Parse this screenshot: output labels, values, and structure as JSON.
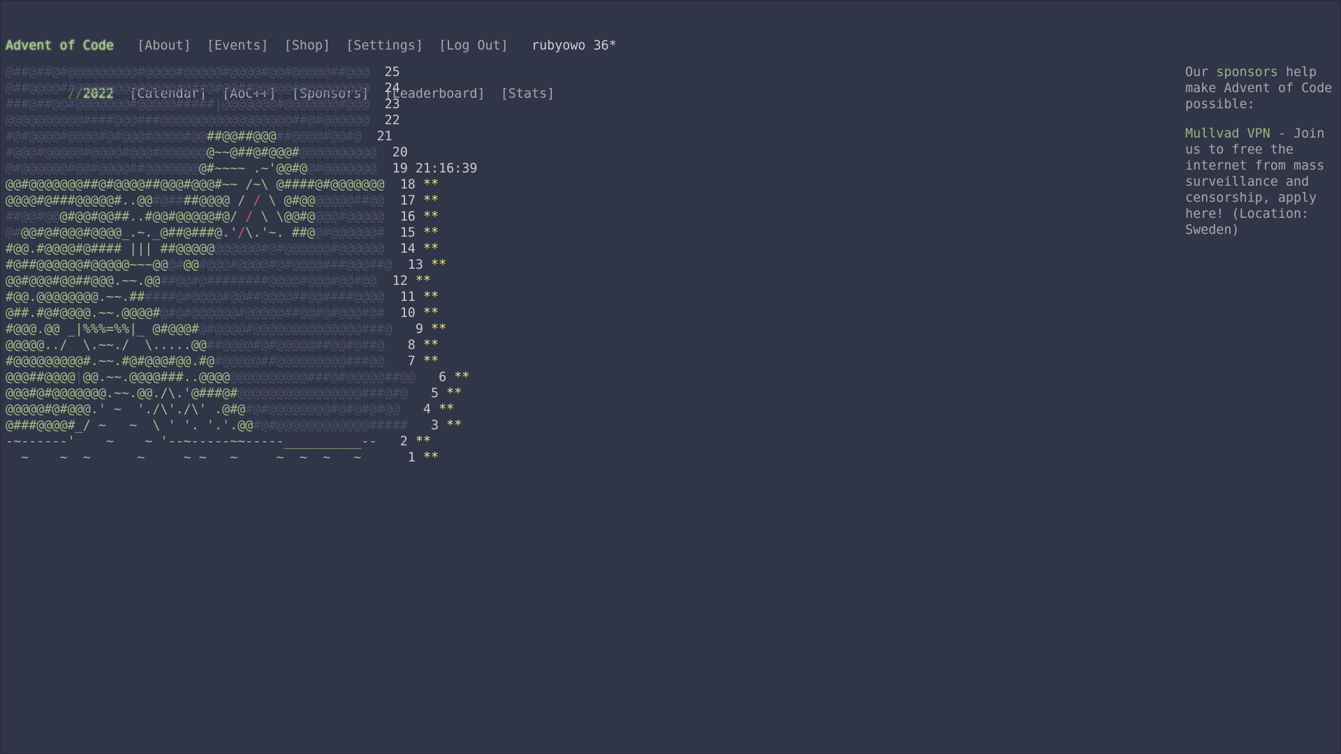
{
  "header": {
    "title": "Advent of Code",
    "nav": [
      "[About]",
      "[Events]",
      "[Shop]",
      "[Settings]",
      "[Log Out]"
    ],
    "user": "rubyowo",
    "star_count": "36*",
    "year_prefix": "//",
    "year": "2022",
    "year_nav": [
      "[Calendar]",
      "[AoC++]",
      "[Sponsors]",
      "[Leaderboard]",
      "[Stats]"
    ]
  },
  "calendar": {
    "days": [
      {
        "day": "25",
        "segments": [
          {
            "t": "@##@##@#@@@@@@@@@#@@@@#@@@@@#@@@@#@@#@@@@@##@@@",
            "c": "dim"
          }
        ],
        "timer": "",
        "stars": ""
      },
      {
        "day": "24",
        "segments": [
          {
            "t": "@##@@@@##@@@@@@@@@@@@@#@##@#@@##@@@@@#@@@@@@@@@",
            "c": "dim"
          }
        ],
        "timer": "",
        "stars": ""
      },
      {
        "day": "23",
        "segments": [
          {
            "t": "###@##@@#@@@@@@@#@@@@@#####|@@@@@@@#@@@@@@@#@@@",
            "c": "dim"
          }
        ],
        "timer": "",
        "stars": ""
      },
      {
        "day": "22",
        "segments": [
          {
            "t": "@@@@@@@@@@####@@@###@@@@@@@@@@@@@@@@@##@#@@@@@@",
            "c": "dim"
          }
        ],
        "timer": "",
        "stars": ""
      },
      {
        "day": "21",
        "segments": [
          {
            "t": "#@#@@@@#@@@@#@#@@@#@@@@#@@",
            "c": "dim"
          },
          {
            "t": "##@@##@@@",
            "c": "lit"
          },
          {
            "t": "##@@@@#@@#@",
            "c": "dim"
          }
        ],
        "timer": "",
        "stars": ""
      },
      {
        "day": "20",
        "segments": [
          {
            "t": "#@@@#@@@@@#@@@@#@@@#@@@@@@",
            "c": "dim"
          },
          {
            "t": "@~~@##@#@@@#",
            "c": "lit"
          },
          {
            "t": "@@@@@@@@@@",
            "c": "dim"
          }
        ],
        "timer": "",
        "stars": ""
      },
      {
        "day": "19",
        "segments": [
          {
            "t": "@#@@@@@@#@@#@@@@##@@@@@@@",
            "c": "dim"
          },
          {
            "t": "@#~~~~ .~'@@#@",
            "c": "lit"
          },
          {
            "t": "@#@@@@@@@",
            "c": "dim"
          }
        ],
        "timer": "21:16:39",
        "stars": ""
      },
      {
        "day": "18",
        "segments": [
          {
            "t": "@@#@@@@@@@##@#@@@@##@@@#@@@#~~ /~\\ @####",
            "c": "lit"
          },
          {
            "t": "@#@@@@@@@",
            "c": "lit"
          }
        ],
        "timer": "",
        "stars": "**"
      },
      {
        "day": "17",
        "segments": [
          {
            "t": "@@@@#@###@",
            "c": "lit"
          },
          {
            "t": "@@@@#..@@",
            "c": "lit"
          },
          {
            "t": "#@##",
            "c": "dim"
          },
          {
            "t": "##@@@@ / ",
            "c": "lit"
          },
          {
            "t": "/",
            "c": "red"
          },
          {
            "t": " \\ @#@@",
            "c": "lit"
          },
          {
            "t": "@@@@@##@@",
            "c": "dim"
          }
        ],
        "timer": "",
        "stars": "**"
      },
      {
        "day": "16",
        "segments": [
          {
            "t": "##@@#@@",
            "c": "dim"
          },
          {
            "t": "@#@@#@@##..#@@#@@@@@#@/ ",
            "c": "lit"
          },
          {
            "t": "/",
            "c": "red"
          },
          {
            "t": " \\ \\@@#@",
            "c": "lit"
          },
          {
            "t": "@@@#@@@@@",
            "c": "dim"
          }
        ],
        "timer": "",
        "stars": "**"
      },
      {
        "day": "15",
        "segments": [
          {
            "t": "@#",
            "c": "dim"
          },
          {
            "t": "@@#@#@@@#@@@@_.~._@##@###@.'",
            "c": "lit"
          },
          {
            "t": "/",
            "c": "red"
          },
          {
            "t": "\\.'~. ##@",
            "c": "lit"
          },
          {
            "t": "@#@@@@@@#",
            "c": "dim"
          }
        ],
        "timer": "",
        "stars": "**"
      },
      {
        "day": "14",
        "segments": [
          {
            "t": "#@@.#@@@@#@#### ||| ##@@@@@",
            "c": "lit"
          },
          {
            "t": "@@@@@@#@#@@@@@@#@@@@@@",
            "c": "dim"
          }
        ],
        "timer": "",
        "stars": "**"
      },
      {
        "day": "13",
        "segments": [
          {
            "t": "#@##@@@@@@#@@@@@~~~@@",
            "c": "lit"
          },
          {
            "t": "@#",
            "c": "dim"
          },
          {
            "t": "@@",
            "c": "lit"
          },
          {
            "t": "#@@@#@@@@#@#@@@@###@@@##@",
            "c": "dim"
          }
        ],
        "timer": "",
        "stars": "**"
      },
      {
        "day": "12",
        "segments": [
          {
            "t": "@@#@@@#@@##@@@.~~.@@",
            "c": "lit"
          },
          {
            "t": "##@@#@########@@@@#@@@#@@#@@",
            "c": "dim"
          }
        ],
        "timer": "",
        "stars": "**"
      },
      {
        "day": "11",
        "segments": [
          {
            "t": "#@@.@@@@@@@@.~~.##",
            "c": "lit"
          },
          {
            "t": "####@#@@@@#@@##@@@@##@@####@@@@",
            "c": "dim"
          }
        ],
        "timer": "",
        "stars": "**"
      },
      {
        "day": "10",
        "segments": [
          {
            "t": "@##.#@#@@@@.~~.@@@@#",
            "c": "lit"
          },
          {
            "t": "@#@#@@@@@@#@@@@@##@@#@#@@@#@#",
            "c": "dim"
          }
        ],
        "timer": "",
        "stars": "**"
      },
      {
        "day": "9",
        "segments": [
          {
            "t": "#@@@.@@ _|%%%=%%|_ @#@@@#",
            "c": "lit"
          },
          {
            "t": "@#@@@@#@@@@@@@@@@@@@@###@",
            "c": "dim"
          }
        ],
        "timer": "",
        "stars": "**"
      },
      {
        "day": "8",
        "segments": [
          {
            "t": "@@@@@../  \\.~~./  \\.....@@",
            "c": "lit"
          },
          {
            "t": "##@@@@#@#@@@@@##@@#@##@",
            "c": "dim"
          }
        ],
        "timer": "",
        "stars": "**"
      },
      {
        "day": "7",
        "segments": [
          {
            "t": "#@@@@@@@@@#.~~.#@#@@@#@@.#@",
            "c": "lit"
          },
          {
            "t": "#@@@@@##@@@@@@@@@###@@",
            "c": "dim"
          }
        ],
        "timer": "",
        "stars": "**"
      },
      {
        "day": "6",
        "segments": [
          {
            "t": "@@@##@@@@",
            "c": "lit"
          },
          {
            "t": "|",
            "c": "dim"
          },
          {
            "t": "@@.~~.@@@@###..@@@@",
            "c": "lit"
          },
          {
            "t": "@@@@@@@@@@###@#@@@@@##@@",
            "c": "dim"
          }
        ],
        "timer": "",
        "stars": "**"
      },
      {
        "day": "5",
        "segments": [
          {
            "t": "@@@#@#@@@@@@@.~~.@@./\\.'@###@#",
            "c": "lit"
          },
          {
            "t": "@@@@@@@@@@@@@@@@###@#@",
            "c": "dim"
          }
        ],
        "timer": "",
        "stars": "**"
      },
      {
        "day": "4",
        "segments": [
          {
            "t": "@@@@@#@#@@@.' ~  './\\'./\\' .@#@",
            "c": "lit"
          },
          {
            "t": "#@#@@@@@@@@#@#@#@#@@",
            "c": "dim"
          }
        ],
        "timer": "",
        "stars": "**"
      },
      {
        "day": "3",
        "segments": [
          {
            "t": "@###@@@@#_/ ~   ~  \\ ' '. '.'.@@",
            "c": "lit"
          },
          {
            "t": "#@#@@@@@@@@@@@@#####",
            "c": "dim"
          }
        ],
        "timer": "",
        "stars": "**"
      },
      {
        "day": "2",
        "segments": [
          {
            "t": "-~------'    ~    ~ '--~-----~~-----__________--",
            "c": "lit"
          }
        ],
        "timer": "",
        "stars": "**"
      },
      {
        "day": "1",
        "segments": [
          {
            "t": "  ~    ~  ~      ~     ~ ~   ~     ~  ~  ~   ~   ",
            "c": "lit"
          }
        ],
        "timer": "",
        "stars": "**"
      }
    ]
  },
  "sidebar": {
    "intro_pre": "Our ",
    "intro_link": "sponsors",
    "intro_post": " help make Advent of Code possible:",
    "sponsor_name": "Mullvad VPN",
    "sponsor_text": " - Join us to free the internet from mass surveillance and censorship, apply here! (Location: Sweden)"
  }
}
